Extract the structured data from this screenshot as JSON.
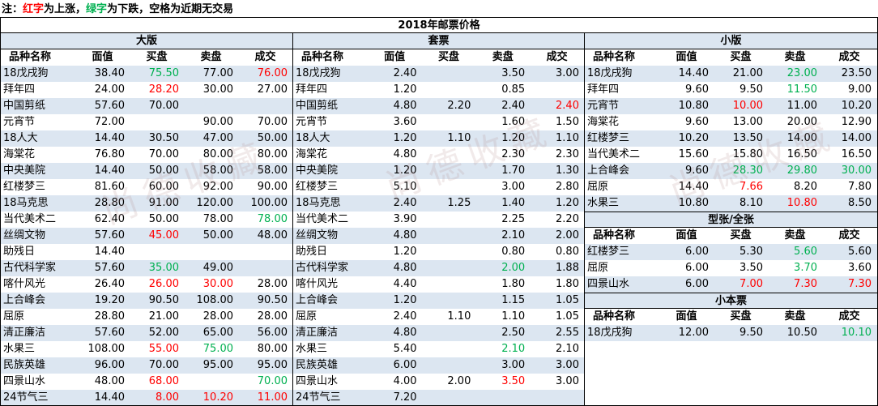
{
  "note": {
    "prefix": "注：",
    "red_word": "红字",
    "mid1": "为上涨，",
    "green_word": "绿字",
    "mid2": "为下跌，空格为近期无交易"
  },
  "title": "2018年邮票价格",
  "headers": [
    "品种名称",
    "面值",
    "买盘",
    "卖盘",
    "成交"
  ],
  "colors": {
    "up": "#ff0000",
    "down": "#00b050",
    "band": "#dce6f1"
  },
  "watermark": "尚德收藏",
  "sections": {
    "daban": {
      "title": "大版",
      "rows": [
        {
          "name": "18戊戌狗",
          "face": "38.40",
          "bid": "75.50",
          "bid_c": "down",
          "ask": "77.00",
          "ask_c": "",
          "deal": "76.00",
          "deal_c": "up"
        },
        {
          "name": "拜年四",
          "face": "24.00",
          "bid": "28.20",
          "bid_c": "up",
          "ask": "30.00",
          "ask_c": "",
          "deal": "27.00",
          "deal_c": ""
        },
        {
          "name": "中国剪纸",
          "face": "57.60",
          "bid": "70.00",
          "bid_c": "",
          "ask": "",
          "ask_c": "",
          "deal": "",
          "deal_c": ""
        },
        {
          "name": "元宵节",
          "face": "72.00",
          "bid": "",
          "bid_c": "",
          "ask": "90.00",
          "ask_c": "",
          "deal": "70.00",
          "deal_c": ""
        },
        {
          "name": "18人大",
          "face": "14.40",
          "bid": "30.50",
          "bid_c": "",
          "ask": "47.00",
          "ask_c": "",
          "deal": "50.00",
          "deal_c": ""
        },
        {
          "name": "海棠花",
          "face": "76.80",
          "bid": "70.00",
          "bid_c": "",
          "ask": "80.00",
          "ask_c": "",
          "deal": "80.00",
          "deal_c": ""
        },
        {
          "name": "中央美院",
          "face": "14.40",
          "bid": "50.00",
          "bid_c": "",
          "ask": "58.00",
          "ask_c": "",
          "deal": "58.00",
          "deal_c": ""
        },
        {
          "name": "红楼梦三",
          "face": "81.60",
          "bid": "60.00",
          "bid_c": "",
          "ask": "92.00",
          "ask_c": "",
          "deal": "90.00",
          "deal_c": ""
        },
        {
          "name": "18马克思",
          "face": "28.80",
          "bid": "91.00",
          "bid_c": "",
          "ask": "120.00",
          "ask_c": "",
          "deal": "100.00",
          "deal_c": ""
        },
        {
          "name": "当代美术二",
          "face": "62.40",
          "bid": "50.00",
          "bid_c": "",
          "ask": "78.00",
          "ask_c": "",
          "deal": "78.00",
          "deal_c": "down"
        },
        {
          "name": "丝绸文物",
          "face": "57.60",
          "bid": "45.00",
          "bid_c": "up",
          "ask": "50.00",
          "ask_c": "",
          "deal": "48.00",
          "deal_c": ""
        },
        {
          "name": "助残日",
          "face": "14.40",
          "bid": "",
          "bid_c": "",
          "ask": "",
          "ask_c": "",
          "deal": "",
          "deal_c": ""
        },
        {
          "name": "古代科学家",
          "face": "57.60",
          "bid": "35.00",
          "bid_c": "down",
          "ask": "49.00",
          "ask_c": "",
          "deal": "",
          "deal_c": ""
        },
        {
          "name": "喀什风光",
          "face": "26.40",
          "bid": "26.00",
          "bid_c": "up",
          "ask": "30.00",
          "ask_c": "up",
          "deal": "28.00",
          "deal_c": ""
        },
        {
          "name": "上合峰会",
          "face": "19.20",
          "bid": "90.50",
          "bid_c": "",
          "ask": "108.00",
          "ask_c": "",
          "deal": "90.50",
          "deal_c": ""
        },
        {
          "name": "屈原",
          "face": "28.80",
          "bid": "21.00",
          "bid_c": "",
          "ask": "28.00",
          "ask_c": "",
          "deal": "28.00",
          "deal_c": ""
        },
        {
          "name": "清正廉洁",
          "face": "57.60",
          "bid": "52.00",
          "bid_c": "",
          "ask": "65.00",
          "ask_c": "",
          "deal": "56.00",
          "deal_c": ""
        },
        {
          "name": "水果三",
          "face": "108.00",
          "bid": "55.00",
          "bid_c": "up",
          "ask": "75.00",
          "ask_c": "down",
          "deal": "80.00",
          "deal_c": ""
        },
        {
          "name": "民族英雄",
          "face": "96.00",
          "bid": "70.00",
          "bid_c": "",
          "ask": "95.00",
          "ask_c": "",
          "deal": "95.00",
          "deal_c": ""
        },
        {
          "name": "四景山水",
          "face": "48.00",
          "bid": "68.00",
          "bid_c": "up",
          "ask": "",
          "ask_c": "",
          "deal": "70.00",
          "deal_c": "down"
        },
        {
          "name": "24节气三",
          "face": "14.40",
          "bid": "8.00",
          "bid_c": "up",
          "ask": "10.20",
          "ask_c": "up",
          "deal": "11.00",
          "deal_c": "up"
        }
      ]
    },
    "taopiao": {
      "title": "套票",
      "rows": [
        {
          "name": "18戊戌狗",
          "face": "2.40",
          "bid": "",
          "bid_c": "",
          "ask": "3.50",
          "ask_c": "",
          "deal": "3.00",
          "deal_c": ""
        },
        {
          "name": "拜年四",
          "face": "1.20",
          "bid": "",
          "bid_c": "",
          "ask": "0.85",
          "ask_c": "",
          "deal": "",
          "deal_c": ""
        },
        {
          "name": "中国剪纸",
          "face": "4.80",
          "bid": "2.20",
          "bid_c": "",
          "ask": "2.40",
          "ask_c": "",
          "deal": "2.40",
          "deal_c": "up"
        },
        {
          "name": "元宵节",
          "face": "3.60",
          "bid": "",
          "bid_c": "",
          "ask": "1.60",
          "ask_c": "",
          "deal": "1.50",
          "deal_c": ""
        },
        {
          "name": "18人大",
          "face": "1.20",
          "bid": "1.10",
          "bid_c": "",
          "ask": "1.20",
          "ask_c": "",
          "deal": "1.10",
          "deal_c": ""
        },
        {
          "name": "海棠花",
          "face": "4.80",
          "bid": "",
          "bid_c": "",
          "ask": "2.30",
          "ask_c": "",
          "deal": "2.30",
          "deal_c": ""
        },
        {
          "name": "中央美院",
          "face": "1.20",
          "bid": "",
          "bid_c": "",
          "ask": "1.70",
          "ask_c": "",
          "deal": "1.30",
          "deal_c": ""
        },
        {
          "name": "红楼梦三",
          "face": "5.10",
          "bid": "",
          "bid_c": "",
          "ask": "3.00",
          "ask_c": "",
          "deal": "2.80",
          "deal_c": ""
        },
        {
          "name": "18马克思",
          "face": "2.40",
          "bid": "1.25",
          "bid_c": "",
          "ask": "1.40",
          "ask_c": "",
          "deal": "1.20",
          "deal_c": ""
        },
        {
          "name": "当代美术二",
          "face": "3.90",
          "bid": "",
          "bid_c": "",
          "ask": "2.25",
          "ask_c": "",
          "deal": "2.20",
          "deal_c": ""
        },
        {
          "name": "丝绸文物",
          "face": "4.80",
          "bid": "",
          "bid_c": "",
          "ask": "2.10",
          "ask_c": "",
          "deal": "2.00",
          "deal_c": ""
        },
        {
          "name": "助残日",
          "face": "1.20",
          "bid": "",
          "bid_c": "",
          "ask": "0.80",
          "ask_c": "",
          "deal": "0.80",
          "deal_c": ""
        },
        {
          "name": "古代科学家",
          "face": "4.80",
          "bid": "",
          "bid_c": "",
          "ask": "2.00",
          "ask_c": "down",
          "deal": "1.88",
          "deal_c": ""
        },
        {
          "name": "喀什风光",
          "face": "4.40",
          "bid": "",
          "bid_c": "",
          "ask": "1.80",
          "ask_c": "",
          "deal": "1.80",
          "deal_c": ""
        },
        {
          "name": "上合峰会",
          "face": "1.20",
          "bid": "",
          "bid_c": "",
          "ask": "1.15",
          "ask_c": "",
          "deal": "1.05",
          "deal_c": ""
        },
        {
          "name": "屈原",
          "face": "2.40",
          "bid": "1.10",
          "bid_c": "",
          "ask": "1.10",
          "ask_c": "",
          "deal": "1.05",
          "deal_c": ""
        },
        {
          "name": "清正廉洁",
          "face": "4.80",
          "bid": "",
          "bid_c": "",
          "ask": "2.50",
          "ask_c": "",
          "deal": "2.55",
          "deal_c": ""
        },
        {
          "name": "水果三",
          "face": "5.40",
          "bid": "",
          "bid_c": "",
          "ask": "2.10",
          "ask_c": "down",
          "deal": "2.10",
          "deal_c": ""
        },
        {
          "name": "民族英雄",
          "face": "6.00",
          "bid": "",
          "bid_c": "",
          "ask": "3.00",
          "ask_c": "",
          "deal": "3.00",
          "deal_c": ""
        },
        {
          "name": "四景山水",
          "face": "4.00",
          "bid": "2.00",
          "bid_c": "",
          "ask": "3.50",
          "ask_c": "up",
          "deal": "3.00",
          "deal_c": ""
        },
        {
          "name": "24节气三",
          "face": "7.20",
          "bid": "",
          "bid_c": "",
          "ask": "",
          "ask_c": "",
          "deal": "",
          "deal_c": ""
        }
      ]
    },
    "xiaoban": {
      "title": "小版",
      "rows": [
        {
          "name": "18戊戌狗",
          "face": "14.40",
          "bid": "21.00",
          "bid_c": "",
          "ask": "23.00",
          "ask_c": "down",
          "deal": "23.50",
          "deal_c": ""
        },
        {
          "name": "拜年四",
          "face": "9.60",
          "bid": "9.50",
          "bid_c": "",
          "ask": "11.50",
          "ask_c": "down",
          "deal": "9.00",
          "deal_c": ""
        },
        {
          "name": "元宵节",
          "face": "10.80",
          "bid": "10.00",
          "bid_c": "up",
          "ask": "11.00",
          "ask_c": "",
          "deal": "10.20",
          "deal_c": ""
        },
        {
          "name": "海棠花",
          "face": "9.60",
          "bid": "13.00",
          "bid_c": "",
          "ask": "20.00",
          "ask_c": "",
          "deal": "12.90",
          "deal_c": ""
        },
        {
          "name": "红楼梦三",
          "face": "10.20",
          "bid": "13.50",
          "bid_c": "",
          "ask": "14.00",
          "ask_c": "",
          "deal": "14.00",
          "deal_c": ""
        },
        {
          "name": "当代美术二",
          "face": "15.60",
          "bid": "15.80",
          "bid_c": "",
          "ask": "16.50",
          "ask_c": "",
          "deal": "16.50",
          "deal_c": ""
        },
        {
          "name": "上合峰会",
          "face": "9.60",
          "bid": "28.30",
          "bid_c": "down",
          "ask": "29.80",
          "ask_c": "down",
          "deal": "30.00",
          "deal_c": "down"
        },
        {
          "name": "屈原",
          "face": "14.40",
          "bid": "7.66",
          "bid_c": "up",
          "ask": "8.20",
          "ask_c": "",
          "deal": "7.80",
          "deal_c": ""
        },
        {
          "name": "水果三",
          "face": "10.80",
          "bid": "8.10",
          "bid_c": "",
          "ask": "10.80",
          "ask_c": "up",
          "deal": "8.50",
          "deal_c": ""
        }
      ]
    },
    "xingzhang": {
      "title": "型张/全张",
      "rows": [
        {
          "name": "红楼梦三",
          "face": "6.00",
          "bid": "5.30",
          "bid_c": "",
          "ask": "5.60",
          "ask_c": "down",
          "deal": "5.60",
          "deal_c": ""
        },
        {
          "name": "屈原",
          "face": "6.00",
          "bid": "3.50",
          "bid_c": "",
          "ask": "3.70",
          "ask_c": "down",
          "deal": "3.60",
          "deal_c": ""
        },
        {
          "name": "四景山水",
          "face": "6.00",
          "bid": "7.00",
          "bid_c": "up",
          "ask": "7.30",
          "ask_c": "up",
          "deal": "7.30",
          "deal_c": "up"
        }
      ]
    },
    "xiaobenpiao": {
      "title": "小本票",
      "rows": [
        {
          "name": "18戊戌狗",
          "face": "12.00",
          "bid": "9.50",
          "bid_c": "",
          "ask": "10.50",
          "ask_c": "",
          "deal": "10.10",
          "deal_c": "down"
        }
      ]
    }
  }
}
